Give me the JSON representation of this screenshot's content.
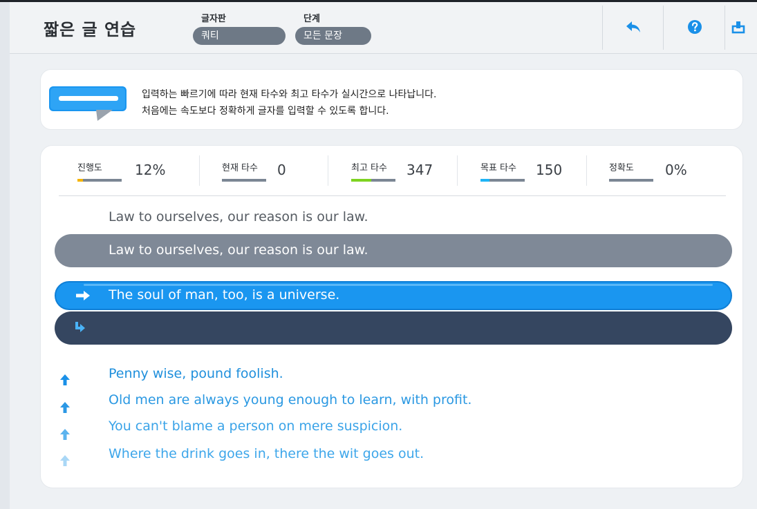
{
  "header": {
    "title": "짧은 글 연습",
    "keyboard": {
      "label": "글자판",
      "value": "쿼티"
    },
    "level": {
      "label": "단계",
      "value": "모든 문장"
    }
  },
  "info": {
    "line1": "입력하는 빠르기에 따라 현재 타수와 최고 타수가 실시간으로 나타납니다.",
    "line2": "처음에는 속도보다 정확하게 글자를 입력할 수 있도록 합니다."
  },
  "stats": [
    {
      "label": "진행도",
      "value": "12%",
      "fill_fraction": 0.12,
      "color": "#f5b400"
    },
    {
      "label": "현재 타수",
      "value": "0",
      "fill_fraction": 0.0,
      "color": "#7b8694"
    },
    {
      "label": "최고 타수",
      "value": "347",
      "fill_fraction": 0.45,
      "color": "#7ed321"
    },
    {
      "label": "목표 타수",
      "value": "150",
      "fill_fraction": 0.2,
      "color": "#1fb4f5"
    },
    {
      "label": "정확도",
      "value": "0%",
      "fill_fraction": 0.0,
      "color": "#7b8694"
    }
  ],
  "practice": {
    "previous_sentence": "Law to ourselves, our reason is our law.",
    "previous_typed": "Law to ourselves, our reason is our law.",
    "current_sentence": "The soul of man, too, is a universe.",
    "current_input": ""
  },
  "upcoming": [
    "Penny wise, pound foolish.",
    "Old men are always young enough to learn, with profit.",
    "You can't blame a person on mere suspicion.",
    "Where the drink goes in, there the wit goes out."
  ],
  "colors": {
    "accent_blue": "#1a96f0",
    "upcoming_text": "#2a9fe0",
    "typed_bar": "#7f8997",
    "input_bar": "#354660"
  }
}
